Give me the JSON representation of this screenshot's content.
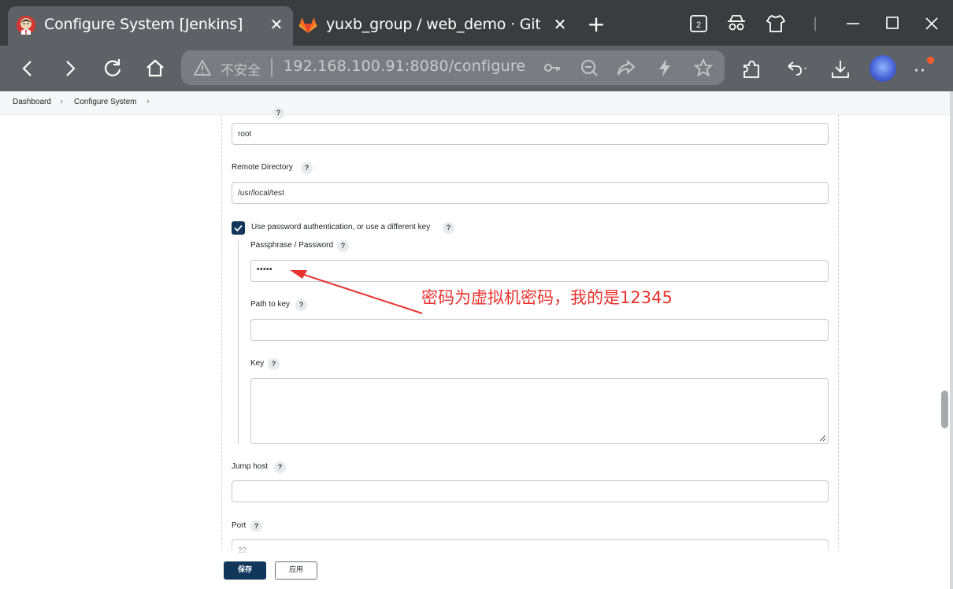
{
  "browser": {
    "tabs": [
      {
        "title": "Configure System [Jenkins]",
        "active": true,
        "favicon": "jenkins-icon"
      },
      {
        "title": "yuxb_group / web_demo · GitLab",
        "active": false,
        "favicon": "gitlab-icon"
      }
    ],
    "tab_count_badge": "2",
    "address": {
      "security_label": "不安全",
      "url": "192.168.100.91:8080/configure"
    },
    "colors": {
      "tabbar": "#3a3d40",
      "toolbar": "#5e6266",
      "omnibox": "#797d81",
      "notification": "#ff5a2c"
    }
  },
  "breadcrumb": {
    "items": [
      "Dashboard",
      "Configure System"
    ]
  },
  "form": {
    "username_value": "root",
    "remote_directory": {
      "label": "Remote Directory",
      "value": "/usr/local/test"
    },
    "use_password": {
      "label": "Use password authentication, or use a different key",
      "checked": true
    },
    "passphrase": {
      "label": "Passphrase / Password",
      "value": "•••••"
    },
    "path_to_key": {
      "label": "Path to key",
      "value": ""
    },
    "key": {
      "label": "Key",
      "value": ""
    },
    "jump_host": {
      "label": "Jump host",
      "value": ""
    },
    "port": {
      "label": "Port",
      "value": "22"
    },
    "help_symbol": "?"
  },
  "annotation": {
    "text": "密码为虚拟机密码，我的是12345",
    "color": "#e8322e"
  },
  "actions": {
    "save_label": "保存",
    "apply_label": "应用",
    "primary_color": "#11375b"
  }
}
